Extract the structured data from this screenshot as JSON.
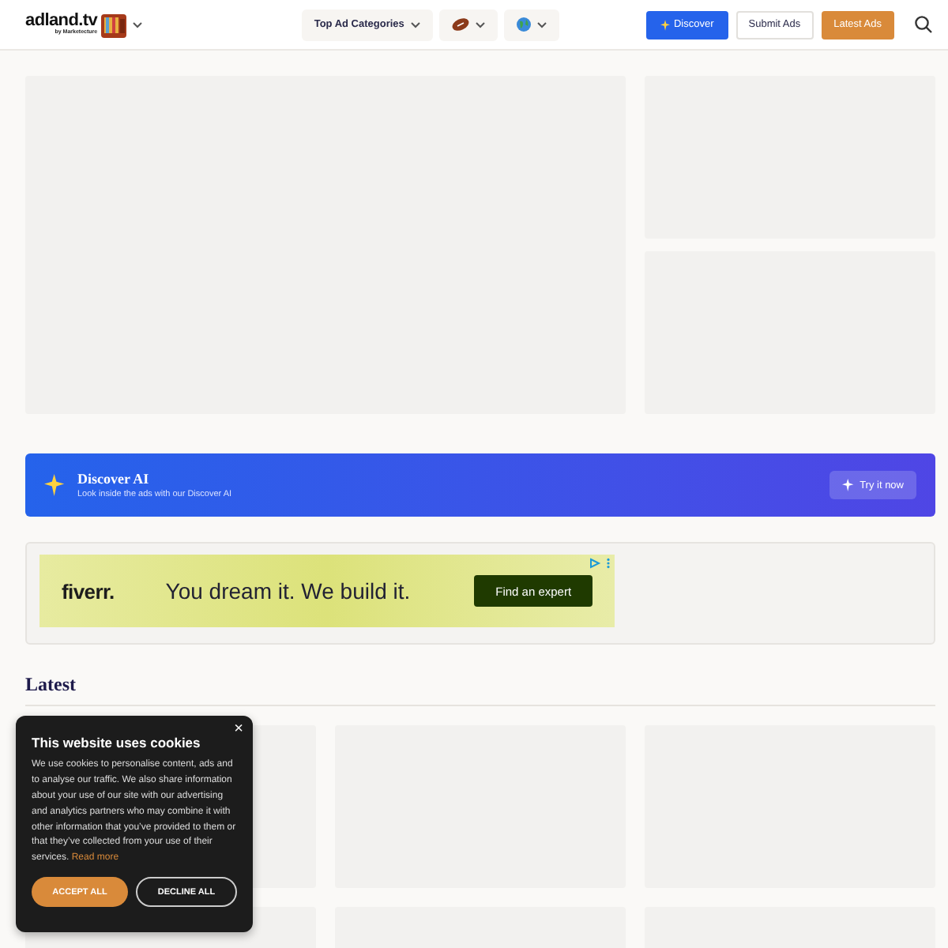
{
  "header": {
    "logo": {
      "name": "adland.tv",
      "byline": "by Marketecture"
    },
    "nav": [
      {
        "kind": "text",
        "label": "Top Ad Categories"
      },
      {
        "kind": "football"
      },
      {
        "kind": "globe"
      }
    ],
    "buttons": [
      {
        "kind": "discover",
        "label": "Discover"
      },
      {
        "kind": "outline",
        "label": "Submit Ads"
      },
      {
        "kind": "orange",
        "label": "Latest Ads"
      }
    ]
  },
  "discover_banner": {
    "title": "Discover AI",
    "subtitle": "Look inside the ads with our Discover AI",
    "button": "Try it now"
  },
  "ad": {
    "brand": "fiverr.",
    "headline": "You dream it. We build it.",
    "button": "Find an expert"
  },
  "latest": {
    "heading": "Latest"
  },
  "cookie_banner": {
    "title": "This website uses cookies",
    "text": "We use cookies to personalise content, ads and to analyse our traffic. We also share information about your use of our site with our advertising and analytics partners who may combine it with other information that you’ve provided to them or that they’ve collected from your use of their services. ",
    "link": "Read more",
    "close": "×",
    "accept": "ACCEPT ALL",
    "decline": "DECLINE ALL"
  }
}
